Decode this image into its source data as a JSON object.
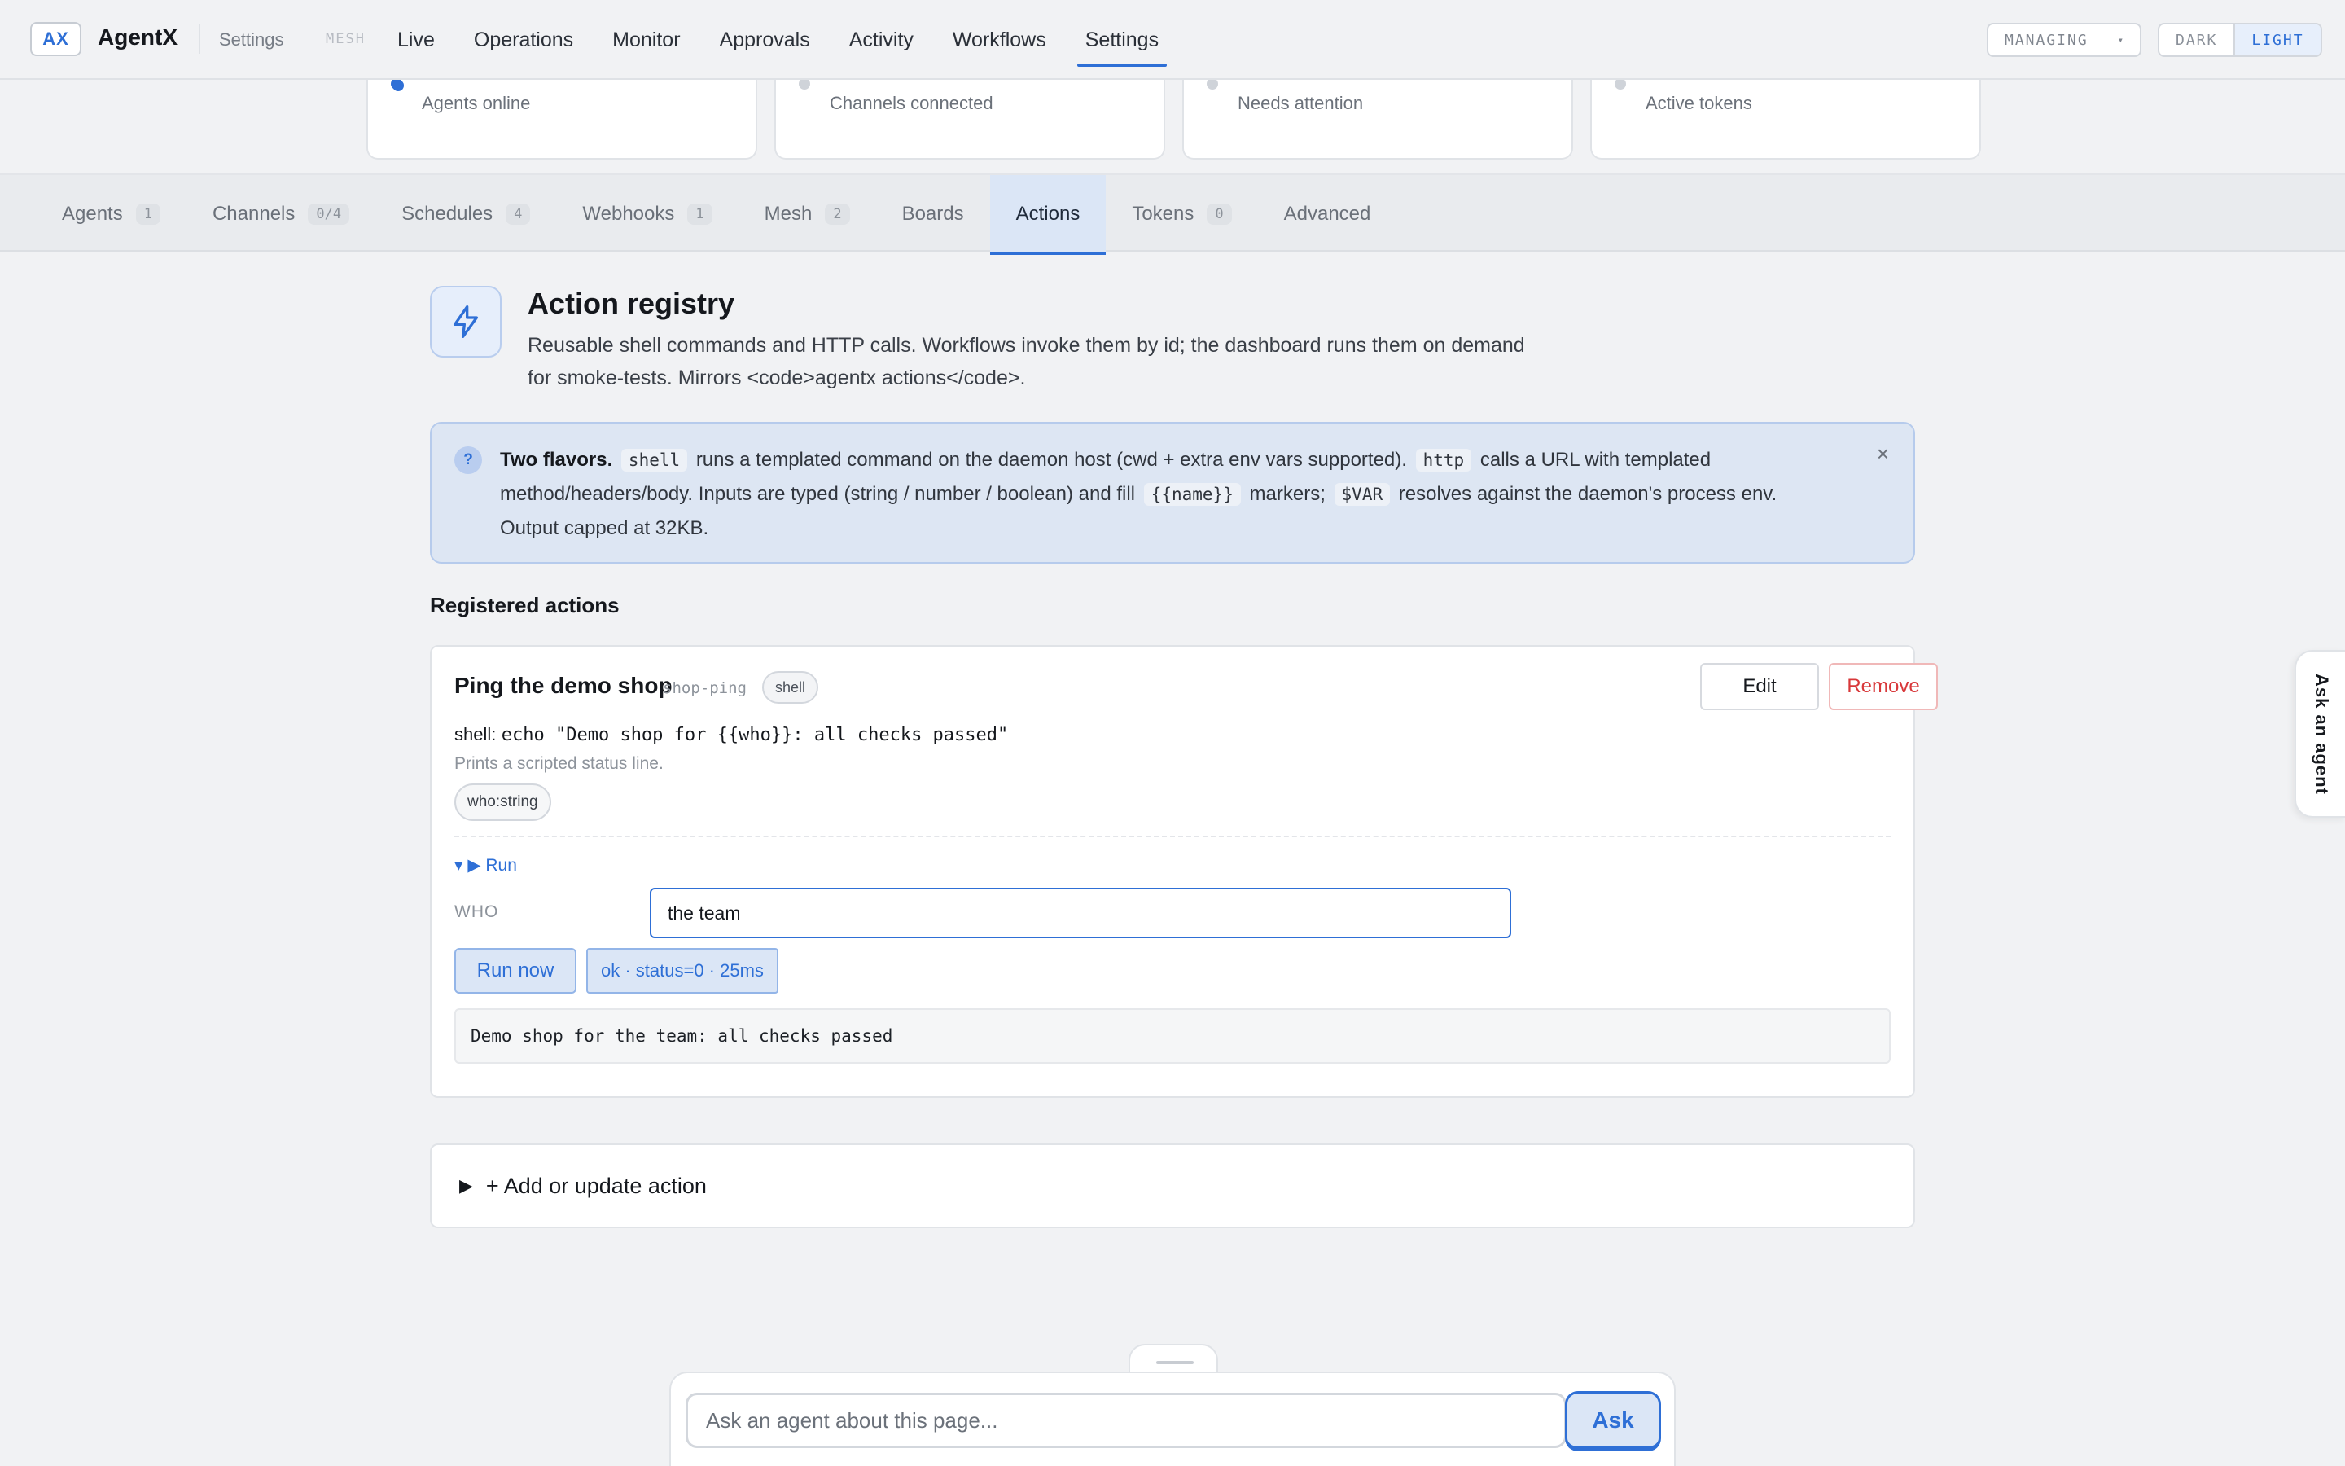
{
  "header": {
    "logo": "AX",
    "brand": "AgentX",
    "crumb": "Settings",
    "mesh_label": "MESH",
    "nav": [
      {
        "label": "Live"
      },
      {
        "label": "Operations"
      },
      {
        "label": "Monitor"
      },
      {
        "label": "Approvals"
      },
      {
        "label": "Activity"
      },
      {
        "label": "Workflows"
      },
      {
        "label": "Settings",
        "active": true
      }
    ],
    "managing": "MANAGING",
    "theme": {
      "dark": "DARK",
      "light": "LIGHT",
      "selected": "LIGHT"
    }
  },
  "stats": [
    {
      "label": "Agents online",
      "status": "online"
    },
    {
      "label": "Channels connected",
      "status": "idle"
    },
    {
      "label": "Needs attention",
      "status": "idle"
    },
    {
      "label": "Active tokens",
      "status": "idle"
    }
  ],
  "tabs": [
    {
      "label": "Agents",
      "count": "1"
    },
    {
      "label": "Channels",
      "count": "0/4"
    },
    {
      "label": "Schedules",
      "count": "4"
    },
    {
      "label": "Webhooks",
      "count": "1"
    },
    {
      "label": "Mesh",
      "count": "2"
    },
    {
      "label": "Boards",
      "count": ""
    },
    {
      "label": "Actions",
      "count": "",
      "active": true
    },
    {
      "label": "Tokens",
      "count": "0"
    },
    {
      "label": "Advanced",
      "count": ""
    }
  ],
  "registry": {
    "icon": "lightning-icon",
    "title": "Action registry",
    "description": "Reusable shell commands and HTTP calls. Workflows invoke them by id; the dashboard runs them on demand for smoke-tests. Mirrors <code>agentx actions</code>."
  },
  "info": {
    "icon": "question-icon",
    "bold": "Two flavors.",
    "chip_shell": "shell",
    "text_1": "runs a templated command on the daemon host (cwd + extra env vars supported).",
    "chip_http": "http",
    "text_2": "calls a URL with templated method/headers/body. Inputs are typed (string / number / boolean) and fill",
    "chip_name": "{{name}}",
    "text_3": "markers;",
    "chip_var": "$VAR",
    "text_4": "resolves against the daemon's process env. Output capped at 32KB.",
    "close": "×"
  },
  "section_title": "Registered actions",
  "action": {
    "title": "Ping the demo shop",
    "id": "shop-ping",
    "kind": "shell",
    "edit_label": "Edit",
    "remove_label": "Remove",
    "cmd_label": "shell:",
    "cmd": "echo \"Demo shop for {{who}}: all checks passed\"",
    "note": "Prints a scripted status line.",
    "param": "who:string",
    "run_toggle": "▾ ▶ Run",
    "who_label": "WHO",
    "who_value": "the team",
    "run_now_label": "Run now",
    "status": "ok · status=0 · 25ms",
    "output": "Demo shop for the team: all checks passed"
  },
  "add_action": {
    "label": "+ Add or update action"
  },
  "side_tab": "Ask an agent",
  "ask": {
    "placeholder": "Ask an agent about this page...",
    "button": "Ask"
  }
}
